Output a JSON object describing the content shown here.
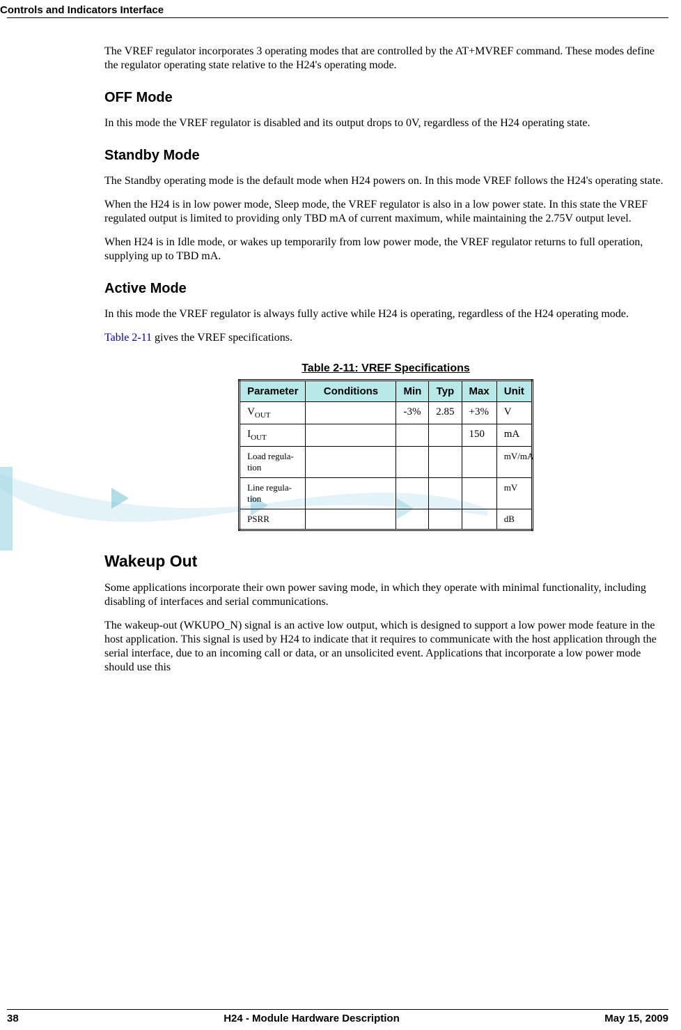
{
  "header": {
    "title": "Controls and Indicators Interface"
  },
  "intro": {
    "p1": "The VREF regulator incorporates 3 operating modes that are controlled by the AT+MVREF command. These modes define the regulator operating state relative to the H24's operating mode."
  },
  "off_mode": {
    "heading": "OFF Mode",
    "p1": "In this mode the VREF regulator is disabled and its output drops to 0V, regardless of the H24 operating state."
  },
  "standby_mode": {
    "heading": "Standby Mode",
    "p1": "The Standby operating mode is the default mode when H24 powers on. In this mode VREF follows the H24's operating state.",
    "p2": "When the H24 is in low power mode, Sleep mode, the VREF regulator is also in a low power state. In this state the VREF regulated output is limited to providing only TBD mA of current maximum, while maintaining the 2.75V output level.",
    "p3": "When H24 is in Idle mode, or wakes up temporarily from low power mode, the VREF regulator returns to full operation, supplying up to TBD mA."
  },
  "active_mode": {
    "heading": "Active Mode",
    "p1": "In this mode the VREF regulator is always fully active while H24 is operating, regardless of the H24 operating mode.",
    "p2_link": "Table 2-11",
    "p2_rest": " gives the VREF specifications."
  },
  "table": {
    "title": "Table 2-11: VREF Specifications",
    "headers": [
      "Parameter",
      "Conditions",
      "Min",
      "Typ",
      "Max",
      "Unit"
    ],
    "rows": [
      {
        "param_main": "V",
        "param_sub": "OUT",
        "cond": "",
        "min": "-3%",
        "typ": "2.85",
        "max": "+3%",
        "unit": "V"
      },
      {
        "param_main": "I",
        "param_sub": "OUT",
        "cond": "",
        "min": "",
        "typ": "",
        "max": "150",
        "unit": "mA"
      },
      {
        "param_main": "Load regula-tion",
        "param_sub": "",
        "cond": "",
        "min": "",
        "typ": "",
        "max": "",
        "unit": "mV/mA"
      },
      {
        "param_main": "Line regula-tion",
        "param_sub": "",
        "cond": "",
        "min": "",
        "typ": "",
        "max": "",
        "unit": "mV"
      },
      {
        "param_main": "PSRR",
        "param_sub": "",
        "cond": "",
        "min": "",
        "typ": "",
        "max": "",
        "unit": "dB"
      }
    ]
  },
  "wakeup": {
    "heading": "Wakeup Out",
    "p1": "Some applications incorporate their own power saving mode, in which they operate with minimal functionality, including disabling of interfaces and serial communications.",
    "p2": "The wakeup-out (WKUPO_N) signal is an active low output, which is designed to support a low power mode feature in the host application. This signal is used by H24 to indicate that it requires to communicate with the host application through the serial interface, due to an incoming call or data, or an unsolicited event. Applications that incorporate a low power mode should use this"
  },
  "footer": {
    "page": "38",
    "doc_title": "H24 - Module Hardware Description",
    "date": "May 15, 2009"
  }
}
